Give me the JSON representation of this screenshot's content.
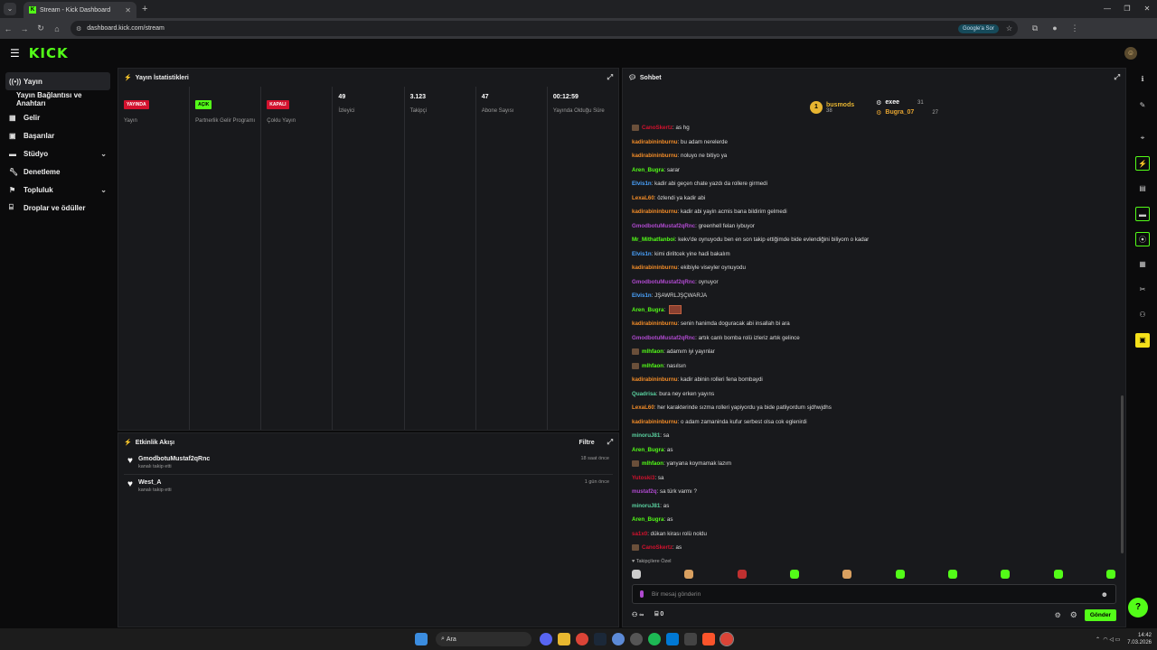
{
  "browser": {
    "tab_title": "Stream - Kick Dashboard",
    "url": "dashboard.kick.com/stream",
    "google_sor": "Google'a Sor"
  },
  "brand": {
    "logo": "KICK",
    "accent": "#53fc18"
  },
  "sidebar": {
    "items": [
      {
        "label": "Yayın",
        "icon": "broadcast-icon",
        "active": true
      },
      {
        "label": "Yayın Bağlantısı ve Anahtarı",
        "icon": "",
        "active": false
      },
      {
        "label": "Gelir",
        "icon": "money-icon"
      },
      {
        "label": "Başarılar",
        "icon": "trophy-icon"
      },
      {
        "label": "Stüdyo",
        "icon": "studio-icon",
        "has_chevron": true
      },
      {
        "label": "Denetleme",
        "icon": "wrench-icon"
      },
      {
        "label": "Topluluk",
        "icon": "users-icon",
        "has_chevron": true
      },
      {
        "label": "Droplar ve ödüller",
        "icon": "gift-icon"
      }
    ]
  },
  "stats_panel": {
    "title": "Yayın İstatistikleri",
    "items": [
      {
        "badge": "YAYINDA",
        "label": "Yayın"
      },
      {
        "badge": "AÇIK",
        "label": "Partnerlik Gelir Programı"
      },
      {
        "badge": "KAPALI",
        "label": "Çoklu Yayın"
      },
      {
        "value": "49",
        "label": "İzleyici"
      },
      {
        "value": "3.123",
        "label": "Takipçi"
      },
      {
        "value": "47",
        "label": "Abone Sayısı"
      },
      {
        "value": "00:12:59",
        "label": "Yayında Olduğu Süre"
      }
    ]
  },
  "activity": {
    "title": "Etkinlik Akışı",
    "filter_label": "Filtre",
    "events": [
      {
        "user": "GmodbotuMustaf2qRnc",
        "action": "kanalı takip etti",
        "time": "18 saat önce"
      },
      {
        "user": "West_A",
        "action": "kanalı takip etti",
        "time": "1 gün önce"
      }
    ]
  },
  "chat": {
    "title": "Sohbet",
    "pinned": {
      "rank": "1",
      "first_user": "busmods",
      "first_count": "38",
      "second_user": "exee",
      "second_count": "31",
      "third_user": "Bugra_07",
      "third_count": "27"
    },
    "messages": [
      {
        "user": "CanoSkertz",
        "text": "as hg",
        "color": "#d3122e",
        "badge": true
      },
      {
        "user": "kadirabininburnu",
        "text": "bu adam nerelerde",
        "color": "#f28c28"
      },
      {
        "user": "kadirabininburnu",
        "text": "noluyo ne bitiyo ya",
        "color": "#f28c28"
      },
      {
        "user": "Aren_Bugra",
        "text": "sarar",
        "color": "#53fc18"
      },
      {
        "user": "Elvis1n",
        "text": "kadir abi geçen chate yazdı da rollere girmedi",
        "color": "#4aa3ff"
      },
      {
        "user": "LexaL60",
        "text": "özlendi ya kadir abi",
        "color": "#f28c28"
      },
      {
        "user": "kadirabininburnu",
        "text": "kadir abi yayin acmis bana bildirim gelmedi",
        "color": "#f28c28"
      },
      {
        "user": "GmodbotuMustaf2qRnc",
        "text": "greenhell felan iybuyor",
        "color": "#b04ad0"
      },
      {
        "user": "Mr_Mithatfanboi",
        "text": "kekv'de oynuyodu ben en son takip ettiğimde bide evlendiğini biliyom o kadar",
        "color": "#53fc18"
      },
      {
        "user": "Elvis1n",
        "text": "kimi diriltcek yine hadi bakalım",
        "color": "#4aa3ff"
      },
      {
        "user": "kadirabininburnu",
        "text": "ekibiyle viseyler oynuyodu",
        "color": "#f28c28"
      },
      {
        "user": "GmodbotuMustaf2qRnc",
        "text": "oynuyor",
        "color": "#b04ad0"
      },
      {
        "user": "Elvis1n",
        "text": "JŞAWRLJŞÇWARJA",
        "color": "#4aa3ff"
      },
      {
        "user": "Aren_Bugra",
        "text": "",
        "color": "#53fc18",
        "emote": true
      },
      {
        "user": "kadirabininburnu",
        "text": "senin hanimda doguracak abi insallah bi ara",
        "color": "#f28c28"
      },
      {
        "user": "GmodbotuMustaf2qRnc",
        "text": "artık canlı bomba rolü izleriz artık gelince",
        "color": "#b04ad0"
      },
      {
        "user": "mlhfaon",
        "text": "adamım iyi yayınlar",
        "color": "#53fc18",
        "badge": true
      },
      {
        "user": "mlhfaon",
        "text": "nasılsın",
        "color": "#53fc18",
        "badge": true
      },
      {
        "user": "kadirabininburnu",
        "text": "kadir abinin rolleri fena bombaydi",
        "color": "#f28c28"
      },
      {
        "user": "Quadrisa",
        "text": "bura ney erken yayıns",
        "color": "#5ad1a0"
      },
      {
        "user": "LexaL60",
        "text": "her karakterinde sızma rolleri yapiyordu ya bide patliyordum sjdhwjdhs",
        "color": "#f28c28"
      },
      {
        "user": "kadirabininburnu",
        "text": "o adam zamaninda kufur serbest olsa cok eglenirdi",
        "color": "#f28c28"
      },
      {
        "user": "minoruJ81",
        "text": "sa",
        "color": "#5ad1a0"
      },
      {
        "user": "Aren_Bugra",
        "text": "as",
        "color": "#53fc18"
      },
      {
        "user": "mlhfaon",
        "text": "yanyana koymamak lazım",
        "color": "#53fc18",
        "badge": true
      },
      {
        "user": "Yutoski3",
        "text": "sa",
        "color": "#d3122e"
      },
      {
        "user": "mustaf2q",
        "text": "sa türk varmı ?",
        "color": "#b04ad0"
      },
      {
        "user": "minoruJ81",
        "text": "as",
        "color": "#5ad1a0"
      },
      {
        "user": "Aren_Bugra",
        "text": "as",
        "color": "#53fc18"
      },
      {
        "user": "sa1x0",
        "text": "dükan kirası rolü noldu",
        "color": "#d3122e"
      },
      {
        "user": "CanoSkertz",
        "text": "as",
        "color": "#d3122e",
        "badge": true
      }
    ],
    "followers_only": "Takipçilere Özel",
    "input_placeholder": "Bir mesaj gönderin",
    "points": "∞",
    "gift_count": "0",
    "send_label": "Gönder"
  },
  "taskbar": {
    "search": "Ara",
    "time": "14:42",
    "date": "7.03.2026"
  }
}
